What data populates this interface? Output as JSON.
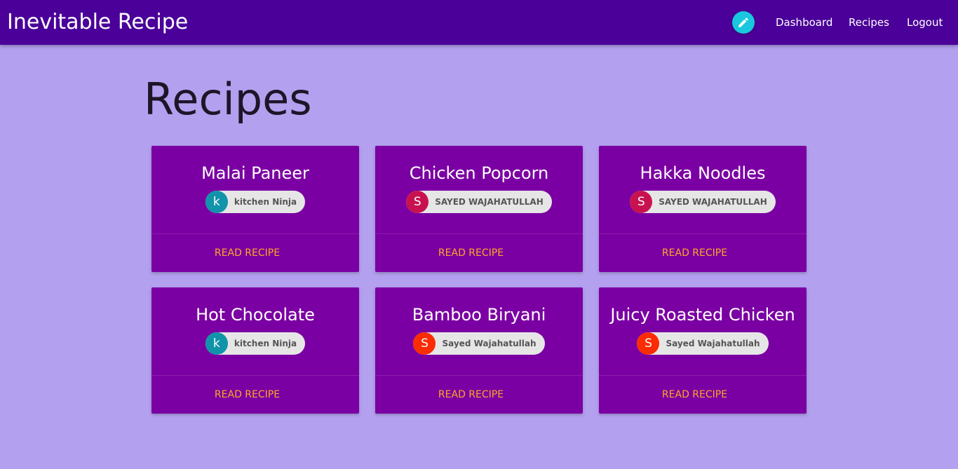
{
  "navbar": {
    "brand": "Inevitable Recipe",
    "links": [
      "Dashboard",
      "Recipes",
      "Logout"
    ],
    "edit_icon": "pencil-icon"
  },
  "page": {
    "title": "Recipes"
  },
  "recipes": [
    {
      "title": "Malai Paneer",
      "author": "kitchen Ninja",
      "initial": "k",
      "avatar_color": "#1193aa",
      "action": "READ RECIPE"
    },
    {
      "title": "Chicken Popcorn",
      "author": "SAYED WAJAHATULLAH",
      "initial": "S",
      "avatar_color": "#c8124f",
      "action": "READ RECIPE"
    },
    {
      "title": "Hakka Noodles",
      "author": "SAYED WAJAHATULLAH",
      "initial": "S",
      "avatar_color": "#c8124f",
      "action": "READ RECIPE"
    },
    {
      "title": "Hot Chocolate",
      "author": "kitchen Ninja",
      "initial": "k",
      "avatar_color": "#1193aa",
      "action": "READ RECIPE"
    },
    {
      "title": "Bamboo Biryani",
      "author": "Sayed Wajahatullah",
      "initial": "S",
      "avatar_color": "#fb2b04",
      "action": "READ RECIPE"
    },
    {
      "title": "Juicy Roasted Chicken",
      "author": "Sayed Wajahatullah",
      "initial": "S",
      "avatar_color": "#fb2b04",
      "action": "READ RECIPE"
    }
  ],
  "colors": {
    "navbar": "#4a0099",
    "background": "#b3a0ef",
    "card": "#7b00a3",
    "action_text": "#ffa726",
    "edit_button": "#19c7df"
  }
}
